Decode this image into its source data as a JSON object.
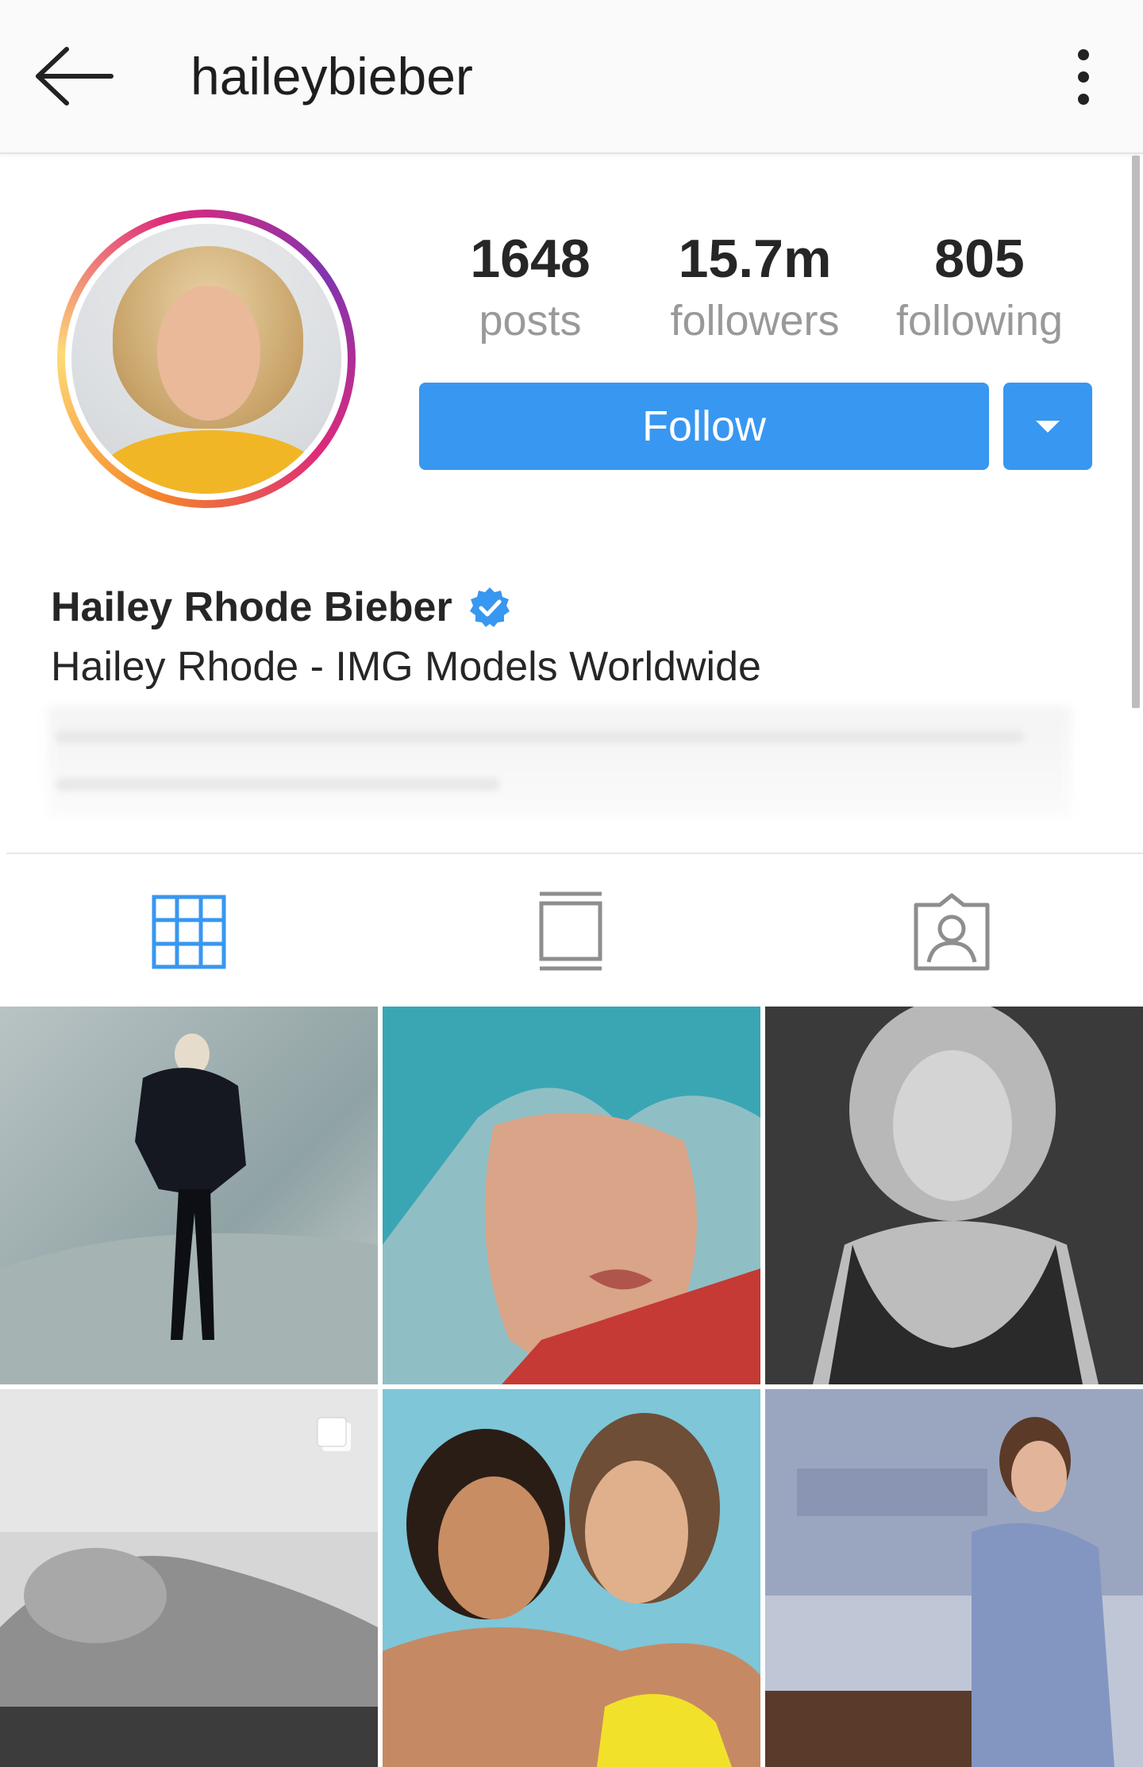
{
  "header": {
    "username": "haileybieber",
    "back_icon": "arrow-left-icon",
    "more_icon": "more-vertical-icon"
  },
  "stats": {
    "posts": {
      "value": "1648",
      "label": "posts"
    },
    "followers": {
      "value": "15.7m",
      "label": "followers"
    },
    "following": {
      "value": "805",
      "label": "following"
    }
  },
  "actions": {
    "follow_label": "Follow",
    "dropdown_icon": "caret-down-icon"
  },
  "profile": {
    "full_name": "Hailey Rhode Bieber",
    "verified": true,
    "bio_line": "Hailey Rhode - IMG Models Worldwide"
  },
  "tabs": [
    {
      "name": "grid",
      "icon": "grid-icon",
      "active": true
    },
    {
      "name": "feed",
      "icon": "feed-icon",
      "active": false
    },
    {
      "name": "tagged",
      "icon": "tagged-icon",
      "active": false
    }
  ],
  "colors": {
    "accent": "#3897f0",
    "muted_text": "#999999",
    "verified": "#3897f0"
  },
  "posts": [
    {
      "kind": "single"
    },
    {
      "kind": "single"
    },
    {
      "kind": "single"
    },
    {
      "kind": "multiple"
    },
    {
      "kind": "single"
    },
    {
      "kind": "single"
    }
  ]
}
